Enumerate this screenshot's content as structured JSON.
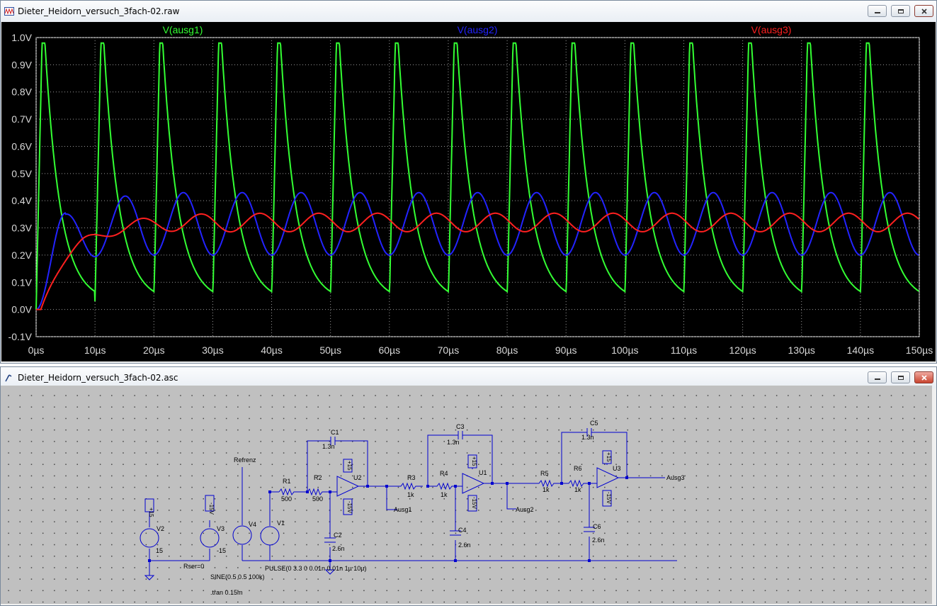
{
  "plot_window": {
    "title": "Dieter_Heidorn_versuch_3fach-02.raw"
  },
  "schematic_window": {
    "title": "Dieter_Heidorn_versuch_3fach-02.asc"
  },
  "chart_data": {
    "type": "line",
    "xlabel": "",
    "ylabel": "",
    "x_ticks": [
      "0µs",
      "10µs",
      "20µs",
      "30µs",
      "40µs",
      "50µs",
      "60µs",
      "70µs",
      "80µs",
      "90µs",
      "100µs",
      "110µs",
      "120µs",
      "130µs",
      "140µs",
      "150µs"
    ],
    "y_ticks": [
      "1.0V",
      "0.9V",
      "0.8V",
      "0.7V",
      "0.6V",
      "0.5V",
      "0.4V",
      "0.3V",
      "0.2V",
      "0.1V",
      "0.0V",
      "-0.1V"
    ],
    "xlim": [
      0,
      150
    ],
    "ylim": [
      -0.1,
      1.0
    ],
    "grid": true,
    "legend_placement": "top",
    "series": [
      {
        "name": "V(ausg1)",
        "color": "#33ff33",
        "description_points": {
          "period_us": 10,
          "peak_v": 0.98,
          "trough_v": 0.03,
          "first_peak_us": 1.5
        }
      },
      {
        "name": "V(ausg2)",
        "color": "#2323ff",
        "description_points": {
          "peak_v": 0.435,
          "trough_v": 0.2,
          "first_peak_us": 5,
          "first_peak_v": 0.355
        }
      },
      {
        "name": "V(ausg3)",
        "color": "#ff2020",
        "description_points": {
          "peak_v": 0.36,
          "trough_v": 0.295,
          "first_plateau_v": 0.235
        }
      }
    ]
  },
  "schematic": {
    "labels": {
      "refrenz": "Refrenz",
      "ausg1": "Ausg1",
      "ausg2": "Ausg2",
      "ausg3": "Ausg3",
      "rser": "Rser=0",
      "pulse": "PULSE(0 3.3 0 0.01n 0.01n 1µ 10µ)",
      "sine": "SINE(0.5 0.5 100k)",
      "tran": ".tran 0.15m"
    },
    "components": [
      {
        "ref": "R1",
        "value": "500"
      },
      {
        "ref": "R2",
        "value": "500"
      },
      {
        "ref": "R3",
        "value": "1k"
      },
      {
        "ref": "R4",
        "value": "1k"
      },
      {
        "ref": "R5",
        "value": "1k"
      },
      {
        "ref": "R6",
        "value": "1k"
      },
      {
        "ref": "C1",
        "value": "1.3n"
      },
      {
        "ref": "C2",
        "value": "2.6n"
      },
      {
        "ref": "C3",
        "value": "1.3n"
      },
      {
        "ref": "C4",
        "value": "2.6n"
      },
      {
        "ref": "C5",
        "value": "1.3n"
      },
      {
        "ref": "C6",
        "value": "2.6n"
      },
      {
        "ref": "U1",
        "value": ""
      },
      {
        "ref": "U2",
        "value": ""
      },
      {
        "ref": "U3",
        "value": ""
      },
      {
        "ref": "V1",
        "value": ""
      },
      {
        "ref": "V2",
        "value": "15"
      },
      {
        "ref": "V3",
        "value": "-15"
      },
      {
        "ref": "V4",
        "value": ""
      }
    ],
    "rails": {
      "pos": "+15",
      "neg": "-15V",
      "pos_v": "+15V"
    }
  }
}
